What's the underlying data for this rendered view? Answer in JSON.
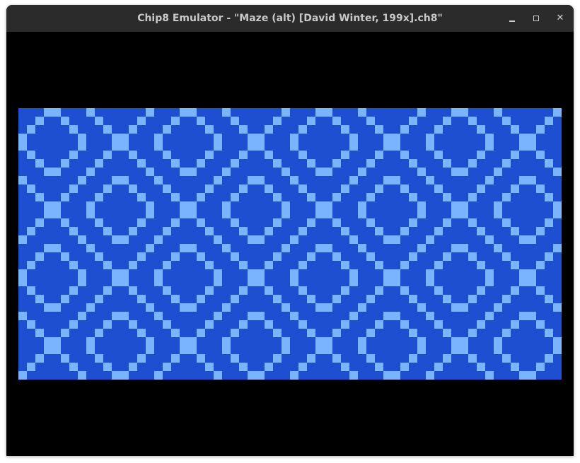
{
  "window": {
    "title": "Chip8 Emulator - \"Maze (alt) [David Winter, 199x].ch8\"",
    "controls": {
      "minimize_icon": "minimize-icon",
      "maximize_icon": "maximize-icon",
      "close_glyph": "✕"
    }
  },
  "display": {
    "columns": 64,
    "rows": 32,
    "background_color": "#1e4fd0",
    "pixel_on_color": "#7ab4ff",
    "pattern": "diagonal maze of light blue pixels on blue background"
  }
}
